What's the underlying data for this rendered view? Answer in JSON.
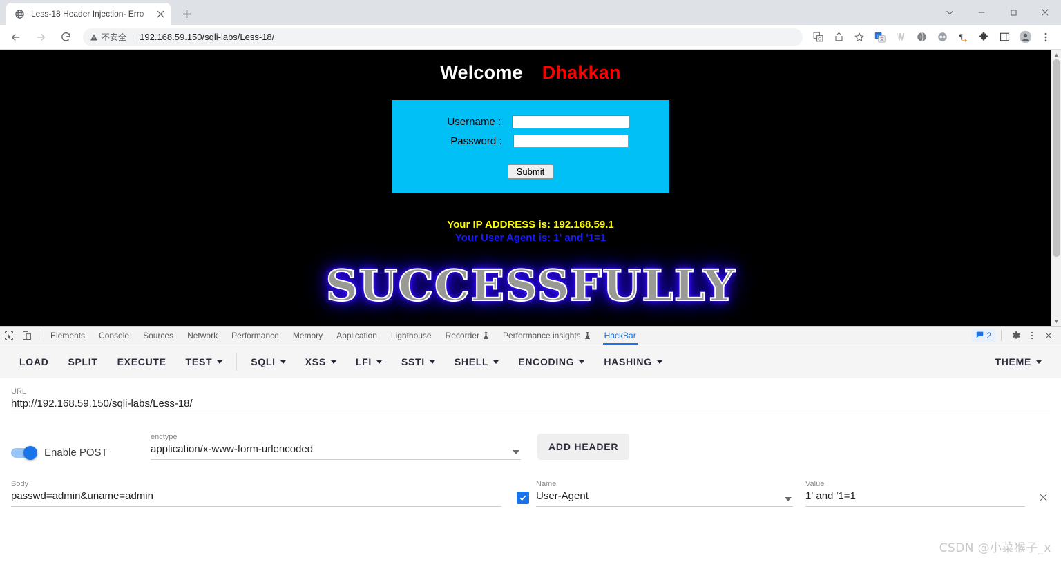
{
  "browser": {
    "tab": {
      "title": "Less-18 Header Injection- Erro",
      "favicon": "globe-icon",
      "close": "×"
    },
    "newtab_label": "+",
    "window_controls": {
      "search_tabs": "⌄",
      "minimize": "–",
      "maximize": "❐",
      "close": "✕"
    },
    "omnibox": {
      "warning_text": "不安全",
      "separator": "|",
      "url": "192.168.59.150/sqli-labs/Less-18/"
    },
    "nav": {
      "back": "←",
      "forward": "→",
      "reload": "↻"
    },
    "toolbar_icons": [
      "translate-icon",
      "share-icon",
      "bookmark-star-icon",
      "google-translate-ext-icon",
      "wappalyzer-icon",
      "globe-ext-icon",
      "proxy-ext-icon",
      "pilcrow-ext-icon",
      "extensions-puzzle-icon",
      "side-panel-icon",
      "profile-avatar-icon",
      "chrome-menu-icon"
    ]
  },
  "page": {
    "welcome": {
      "text": "Welcome",
      "name": "Dhakkan"
    },
    "form": {
      "username_label": "Username :",
      "password_label": "Password :",
      "username_value": "",
      "password_value": "",
      "submit_label": "Submit"
    },
    "ip_line": "Your IP ADDRESS is: 192.168.59.1",
    "user_agent_line": "Your User Agent is: 1' and '1=1",
    "success_banner": "SUCCESSFULLY",
    "colors": {
      "form_bg": "#00c0f5",
      "ip_color": "#ffff00",
      "ua_color": "#1a1aff",
      "name_color": "#ff0000"
    }
  },
  "devtools": {
    "inspect_icon": "inspect-element-icon",
    "device_icon": "device-toolbar-icon",
    "tabs": [
      {
        "label": "Elements",
        "active": false,
        "experimental": false
      },
      {
        "label": "Console",
        "active": false,
        "experimental": false
      },
      {
        "label": "Sources",
        "active": false,
        "experimental": false
      },
      {
        "label": "Network",
        "active": false,
        "experimental": false
      },
      {
        "label": "Performance",
        "active": false,
        "experimental": false
      },
      {
        "label": "Memory",
        "active": false,
        "experimental": false
      },
      {
        "label": "Application",
        "active": false,
        "experimental": false
      },
      {
        "label": "Lighthouse",
        "active": false,
        "experimental": false
      },
      {
        "label": "Recorder",
        "active": false,
        "experimental": true
      },
      {
        "label": "Performance insights",
        "active": false,
        "experimental": true
      },
      {
        "label": "HackBar",
        "active": true,
        "experimental": false
      }
    ],
    "message_count": "2",
    "settings_icon": "gear-icon",
    "more_icon": "kebab-menu-icon",
    "close_icon": "close-icon"
  },
  "hackbar": {
    "buttons": [
      {
        "label": "LOAD",
        "caret": false
      },
      {
        "label": "SPLIT",
        "caret": false
      },
      {
        "label": "EXECUTE",
        "caret": false
      },
      {
        "label": "TEST",
        "caret": true
      },
      {
        "label": "SQLI",
        "caret": true
      },
      {
        "label": "XSS",
        "caret": true
      },
      {
        "label": "LFI",
        "caret": true
      },
      {
        "label": "SSTI",
        "caret": true
      },
      {
        "label": "SHELL",
        "caret": true
      },
      {
        "label": "ENCODING",
        "caret": true
      },
      {
        "label": "HASHING",
        "caret": true
      }
    ],
    "theme": {
      "label": "THEME",
      "caret": true
    },
    "url": {
      "label": "URL",
      "value": "http://192.168.59.150/sqli-labs/Less-18/"
    },
    "post": {
      "toggle_label": "Enable POST",
      "enabled": true
    },
    "enctype": {
      "label": "enctype",
      "value": "application/x-www-form-urlencoded"
    },
    "add_header_label": "ADD HEADER",
    "body": {
      "label": "Body",
      "value": "passwd=admin&uname=admin"
    },
    "header_row": {
      "checked": true,
      "name_label": "Name",
      "name_value": "User-Agent",
      "value_label": "Value",
      "value_value": "1' and '1=1",
      "remove_label": "✕"
    }
  },
  "watermark": "CSDN @小菜猴子_x"
}
